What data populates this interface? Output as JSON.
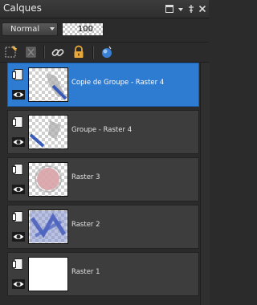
{
  "panel": {
    "title": "Calques"
  },
  "titlebar_buttons": [
    "restore",
    "dropdown",
    "pin",
    "close"
  ],
  "blend": {
    "mode": "Normal",
    "opacity": "100"
  },
  "toolbar": {
    "icons": [
      "new-layer-icon",
      "delete-layer-icon",
      "link-icon",
      "lock-icon",
      "layer-properties-icon"
    ]
  },
  "layers": [
    {
      "name": "Copie de Groupe - Raster 4",
      "selected": true
    },
    {
      "name": "Groupe - Raster 4",
      "selected": false
    },
    {
      "name": "Raster 3",
      "selected": false
    },
    {
      "name": "Raster 2",
      "selected": false
    },
    {
      "name": "Raster 1",
      "selected": false
    }
  ],
  "colors": {
    "selection": "#2e7bd2",
    "panel": "#2b2b2b",
    "row": "#3d3d3d"
  }
}
